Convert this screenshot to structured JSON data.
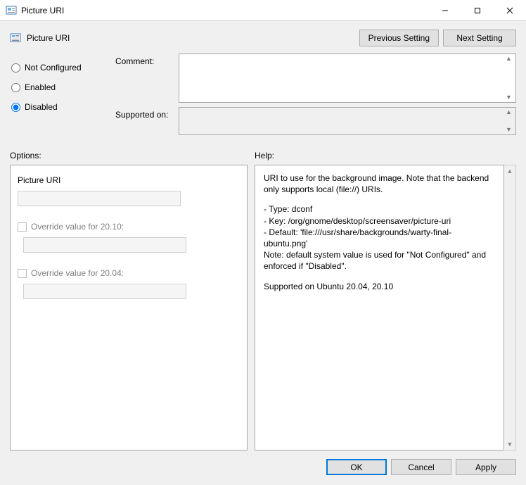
{
  "window": {
    "title": "Picture URI"
  },
  "header": {
    "title": "Picture URI",
    "prev_label": "Previous Setting",
    "next_label": "Next Setting"
  },
  "state": {
    "not_configured_label": "Not Configured",
    "enabled_label": "Enabled",
    "disabled_label": "Disabled",
    "selected": "disabled"
  },
  "fields": {
    "comment_label": "Comment:",
    "comment_value": "",
    "supported_label": "Supported on:",
    "supported_value": ""
  },
  "sections": {
    "options_label": "Options:",
    "help_label": "Help:"
  },
  "options": {
    "main_label": "Picture URI",
    "main_value": "",
    "override1_label": "Override value for 20.10:",
    "override1_checked": false,
    "override1_value": "",
    "override2_label": "Override value for 20.04:",
    "override2_checked": false,
    "override2_value": ""
  },
  "help": {
    "line1": "URI to use for the background image. Note that the backend only supports local (file://) URIs.",
    "type_line": "- Type: dconf",
    "key_line": "- Key: /org/gnome/desktop/screensaver/picture-uri",
    "default_line": "- Default: 'file:///usr/share/backgrounds/warty-final-ubuntu.png'",
    "note_line": "Note: default system value is used for \"Not Configured\" and enforced if \"Disabled\".",
    "supported_line": "Supported on Ubuntu 20.04, 20.10"
  },
  "buttons": {
    "ok": "OK",
    "cancel": "Cancel",
    "apply": "Apply"
  }
}
